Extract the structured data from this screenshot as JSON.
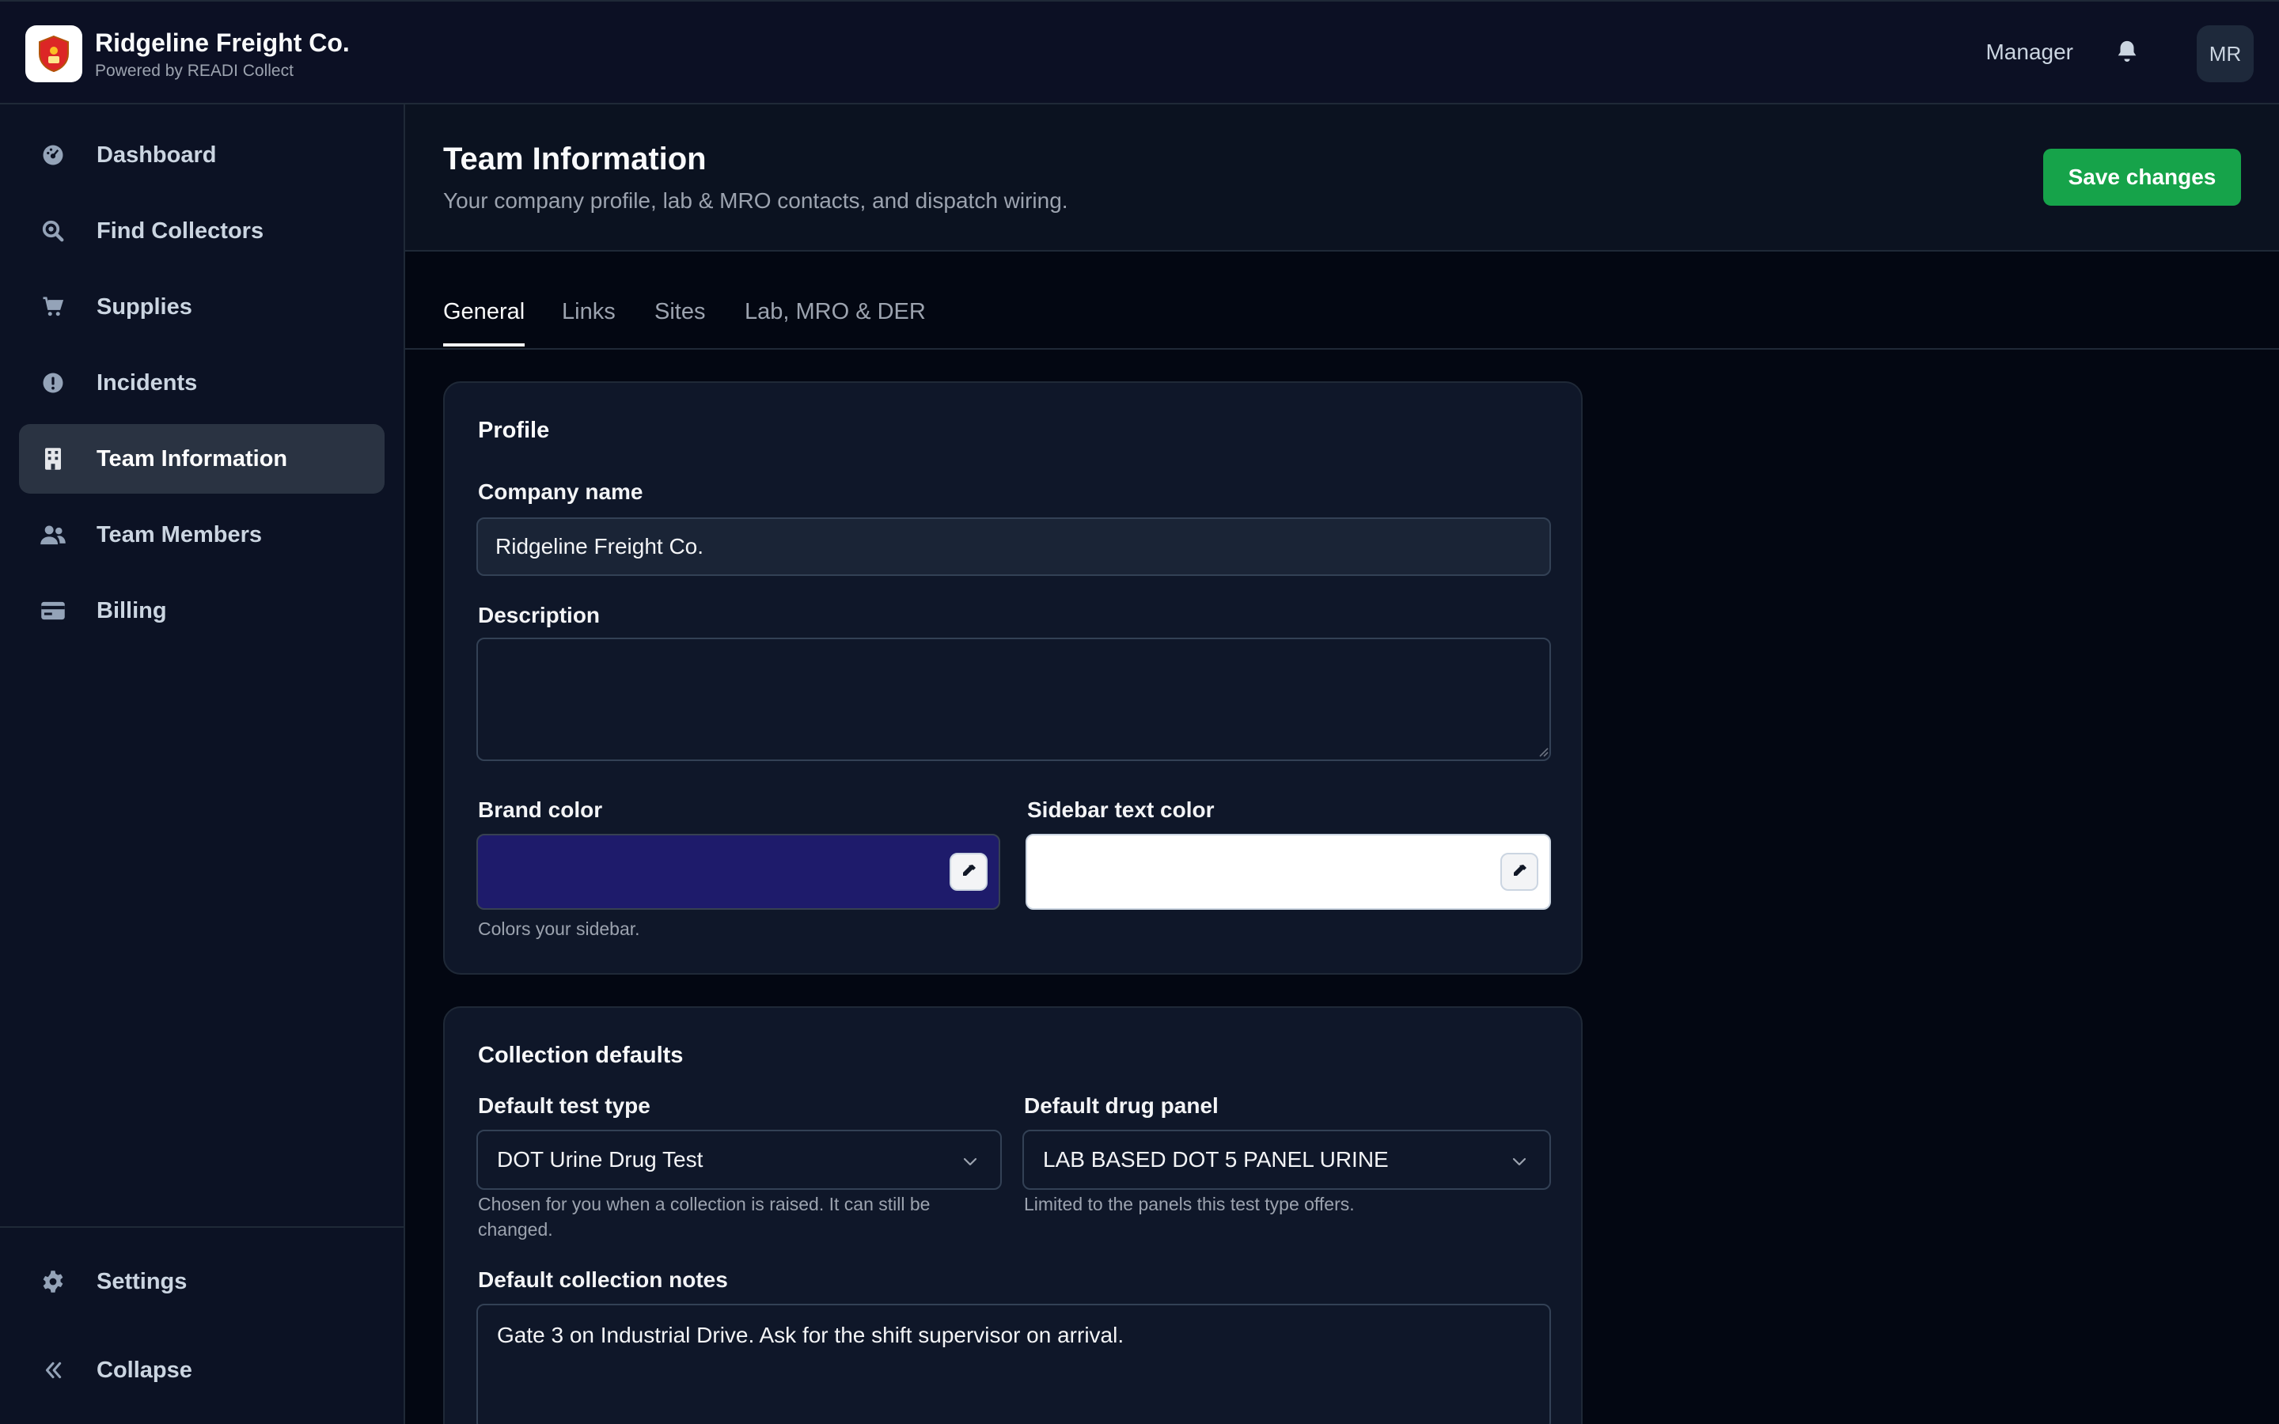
{
  "header": {
    "company": "Ridgeline Freight Co.",
    "powered_by": "Powered by READI Collect",
    "role": "Manager",
    "avatar_initials": "MR"
  },
  "sidebar": {
    "items": [
      {
        "label": "Dashboard",
        "icon": "dashboard-icon"
      },
      {
        "label": "Find Collectors",
        "icon": "search-icon"
      },
      {
        "label": "Supplies",
        "icon": "cart-icon"
      },
      {
        "label": "Incidents",
        "icon": "alert-icon"
      },
      {
        "label": "Team Information",
        "icon": "building-icon",
        "active": true
      },
      {
        "label": "Team Members",
        "icon": "users-icon"
      },
      {
        "label": "Billing",
        "icon": "credit-card-icon"
      }
    ],
    "settings_label": "Settings",
    "collapse_label": "Collapse"
  },
  "page": {
    "title": "Team Information",
    "subtitle": "Your company profile, lab & MRO contacts, and dispatch wiring.",
    "save_label": "Save changes"
  },
  "tabs": [
    "General",
    "Links",
    "Sites",
    "Lab, MRO & DER"
  ],
  "profile": {
    "title": "Profile",
    "company_name_label": "Company name",
    "company_name_value": "Ridgeline Freight Co.",
    "description_label": "Description",
    "description_value": "",
    "brand_color_label": "Brand color",
    "brand_color_value": "#1e1b6b",
    "brand_color_hint": "Colors your sidebar.",
    "sidebar_text_color_label": "Sidebar text color",
    "sidebar_text_color_value": "#ffffff"
  },
  "collection_defaults": {
    "title": "Collection defaults",
    "test_type_label": "Default test type",
    "test_type_value": "DOT Urine Drug Test",
    "test_type_hint": "Chosen for you when a collection is raised. It can still be changed.",
    "drug_panel_label": "Default drug panel",
    "drug_panel_value": "LAB BASED DOT 5 PANEL URINE",
    "drug_panel_hint": "Limited to the panels this test type offers.",
    "notes_label": "Default collection notes",
    "notes_value": "Gate 3 on Industrial Drive. Ask for the shift supervisor on arrival."
  },
  "colors": {
    "accent_green": "#16a34a",
    "logo_red": "#dc2626"
  }
}
